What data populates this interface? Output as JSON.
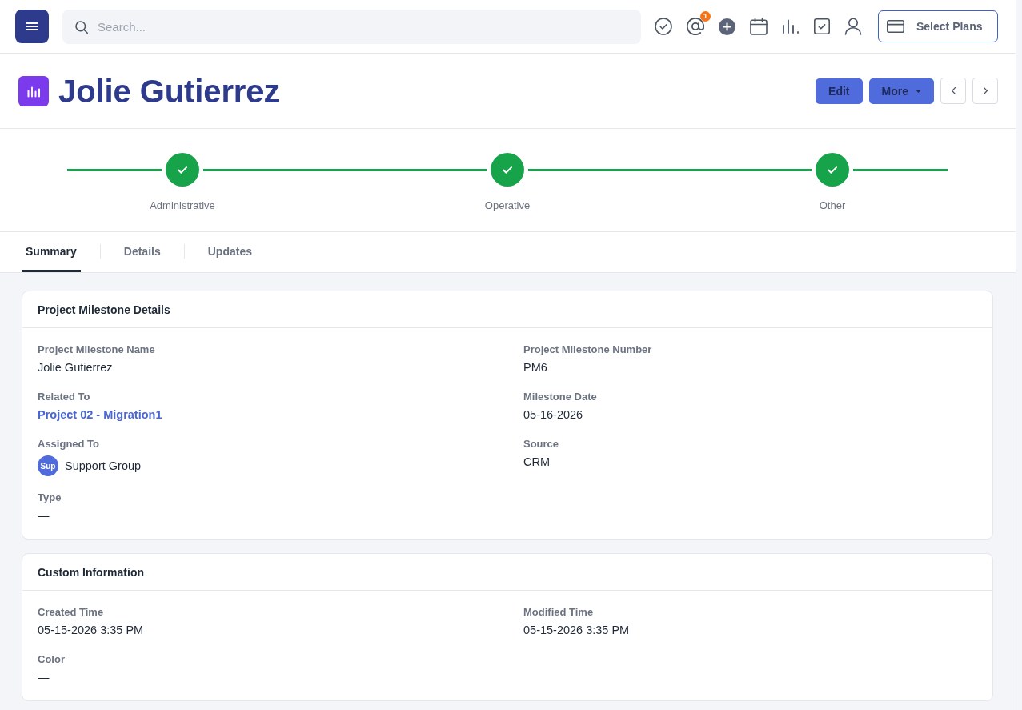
{
  "topbar": {
    "search": {
      "placeholder": "Search..."
    },
    "mention_count": "1",
    "plans_button": "Select Plans"
  },
  "header": {
    "title": "Jolie Gutierrez",
    "actions": [
      {
        "label": "Edit",
        "kind": "button"
      },
      {
        "label": "More",
        "kind": "dropdown"
      }
    ]
  },
  "stages": [
    {
      "label": "Administrative",
      "done": true
    },
    {
      "label": "Operative",
      "done": true
    },
    {
      "label": "Other",
      "done": true
    }
  ],
  "tabs": [
    {
      "label": "Summary",
      "selected": true
    },
    {
      "label": "Details",
      "selected": false
    },
    {
      "label": "Updates",
      "selected": false
    }
  ],
  "sections": [
    {
      "title": "Project Milestone Details",
      "fields": [
        {
          "label": "Project Milestone Name",
          "value": "Jolie Gutierrez",
          "kind": "text"
        },
        {
          "label": "Project Milestone Number",
          "value": "PM6",
          "kind": "text"
        },
        {
          "label": "Related To",
          "value": "Project 02 - Migration1",
          "kind": "link"
        },
        {
          "label": "Milestone Date",
          "value": "05-16-2026",
          "kind": "text"
        },
        {
          "label": "Assigned To",
          "value": "Support Group",
          "kind": "user",
          "avatar": "Sup"
        },
        {
          "label": "Source",
          "value": "CRM",
          "kind": "text"
        },
        {
          "label": "Type",
          "value": "—",
          "kind": "text"
        }
      ]
    },
    {
      "title": "Custom Information",
      "fields": [
        {
          "label": "Created Time",
          "value": "05-15-2026 3:35 PM",
          "kind": "text"
        },
        {
          "label": "Modified Time",
          "value": "05-15-2026 3:35 PM",
          "kind": "text"
        },
        {
          "label": "Color",
          "value": "—",
          "kind": "text"
        }
      ]
    }
  ]
}
